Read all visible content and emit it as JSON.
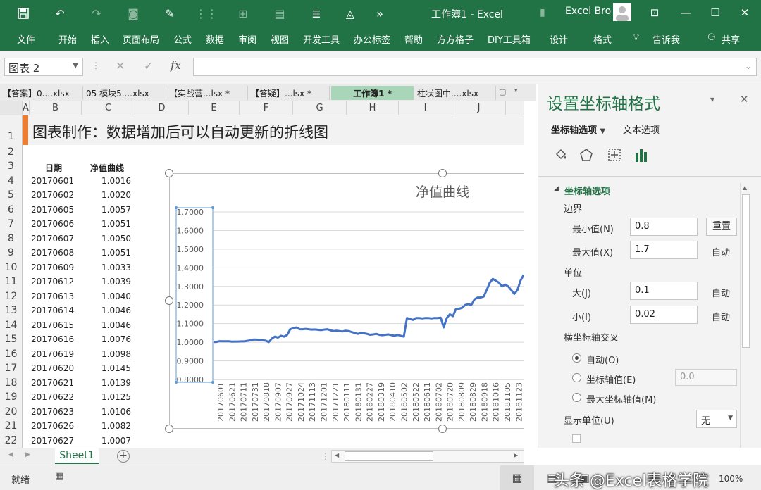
{
  "titlebar": {
    "title": "工作簿1 - Excel",
    "user": "Excel Bro"
  },
  "colors": {
    "accent": "#217346",
    "series_line": "#4472c4",
    "active_tab": "#a9d6b8",
    "title_marker": "#ed7d31"
  },
  "ribbon": {
    "tabs": [
      "文件",
      "开始",
      "插入",
      "页面布局",
      "公式",
      "数据",
      "审阅",
      "视图",
      "开发工具",
      "办公标签",
      "帮助",
      "方方格子",
      "DIY工具箱",
      "设计",
      "格式"
    ],
    "tell_me": "告诉我",
    "share": "共享"
  },
  "formula_bar": {
    "name_box": "图表 2",
    "fx": "fx",
    "formula": ""
  },
  "doc_tabs": [
    "【答案】0....xlsx",
    "05 模块5....xlsx",
    "【实战营...lsx *",
    "【答疑】...lsx *",
    "工作簿1 *",
    "柱状图中....xlsx"
  ],
  "sheet": {
    "columns": [
      "A",
      "B",
      "C",
      "D",
      "E",
      "F",
      "G",
      "H",
      "I",
      "J"
    ],
    "rows": [
      "1",
      "2",
      "3",
      "4",
      "5",
      "6",
      "7",
      "8",
      "9",
      "10",
      "11",
      "12",
      "13",
      "14",
      "15",
      "16",
      "17",
      "18",
      "19",
      "20",
      "21",
      "22"
    ],
    "banner": "图表制作：数据增加后可以自动更新的折线图",
    "header_date": "日期",
    "header_nav": "净值曲线",
    "data_rows": [
      [
        "20170601",
        "1.0016"
      ],
      [
        "20170602",
        "1.0020"
      ],
      [
        "20170605",
        "1.0057"
      ],
      [
        "20170606",
        "1.0051"
      ],
      [
        "20170607",
        "1.0050"
      ],
      [
        "20170608",
        "1.0051"
      ],
      [
        "20170609",
        "1.0033"
      ],
      [
        "20170612",
        "1.0039"
      ],
      [
        "20170613",
        "1.0040"
      ],
      [
        "20170614",
        "1.0046"
      ],
      [
        "20170615",
        "1.0046"
      ],
      [
        "20170616",
        "1.0076"
      ],
      [
        "20170619",
        "1.0098"
      ],
      [
        "20170620",
        "1.0145"
      ],
      [
        "20170621",
        "1.0139"
      ],
      [
        "20170622",
        "1.0125"
      ],
      [
        "20170623",
        "1.0106"
      ],
      [
        "20170626",
        "1.0082"
      ],
      [
        "20170627",
        "1.0007"
      ]
    ]
  },
  "chart_data": {
    "type": "line",
    "title": "净值曲线",
    "ylim": [
      0.8,
      1.7
    ],
    "yticks": [
      "0.8000",
      "0.9000",
      "1.0000",
      "1.1000",
      "1.2000",
      "1.3000",
      "1.4000",
      "1.5000",
      "1.6000",
      "1.7000"
    ],
    "xticks": [
      "20170601",
      "20170621",
      "20170711",
      "20170731",
      "20170818",
      "20170907",
      "20170927",
      "20171024",
      "20171113",
      "20171201",
      "20171221",
      "20180111",
      "20180131",
      "20180227",
      "20180319",
      "20180410",
      "20180502",
      "20180522",
      "20180611",
      "20180702",
      "20180720",
      "20180809",
      "20180829",
      "20180918",
      "20181016",
      "20181105",
      "20181123"
    ],
    "series": [
      {
        "values": [
          1.0016,
          1.002,
          1.0057,
          1.0051,
          1.005,
          1.0051,
          1.0033,
          1.0039,
          1.004,
          1.0046,
          1.0046,
          1.0076,
          1.0098,
          1.0145,
          1.0139,
          1.0125,
          1.0106,
          1.0082,
          1.0007,
          1.02,
          1.03,
          1.025,
          1.035,
          1.03,
          1.04,
          1.07,
          1.075,
          1.08,
          1.07,
          1.07,
          1.072,
          1.07,
          1.068,
          1.069,
          1.067,
          1.065,
          1.068,
          1.07,
          1.065,
          1.06,
          1.062,
          1.06,
          1.058,
          1.062,
          1.06,
          1.055,
          1.05,
          1.045,
          1.05,
          1.048,
          1.045,
          1.04,
          1.042,
          1.045,
          1.04,
          1.038,
          1.04,
          1.042,
          1.038,
          1.035,
          1.04,
          1.035,
          1.03,
          1.13,
          1.125,
          1.12,
          1.13,
          1.13,
          1.128,
          1.13,
          1.13,
          1.128,
          1.13,
          1.13,
          1.132,
          1.08,
          1.13,
          1.15,
          1.14,
          1.18,
          1.18,
          1.185,
          1.2,
          1.205,
          1.2,
          1.23,
          1.24,
          1.24,
          1.245,
          1.28,
          1.32,
          1.34,
          1.33,
          1.32,
          1.3,
          1.31,
          1.3,
          1.28,
          1.26,
          1.28,
          1.33,
          1.36
        ]
      }
    ],
    "grid": true
  },
  "pane": {
    "title": "设置坐标轴格式",
    "tab_axis": "坐标轴选项",
    "tab_text": "文本选项",
    "section": "坐标轴选项",
    "bounds": "边界",
    "min_label": "最小值(N)",
    "min_value": "0.8",
    "reset": "重置",
    "max_label": "最大值(X)",
    "max_value": "1.7",
    "auto": "自动",
    "units": "单位",
    "major_label": "大(J)",
    "major_value": "0.1",
    "minor_label": "小(I)",
    "minor_value": "0.02",
    "cross": "横坐标轴交叉",
    "opt_auto": "自动(O)",
    "opt_value": "坐标轴值(E)",
    "opt_value_input": "0.0",
    "opt_max": "最大坐标轴值(M)",
    "display_units": "显示单位(U)",
    "display_units_value": "无"
  },
  "sheet_tab": "Sheet1",
  "status": {
    "ready": "就绪",
    "zoom": "100%",
    "watermark": "头条 @Excel表格学院"
  }
}
